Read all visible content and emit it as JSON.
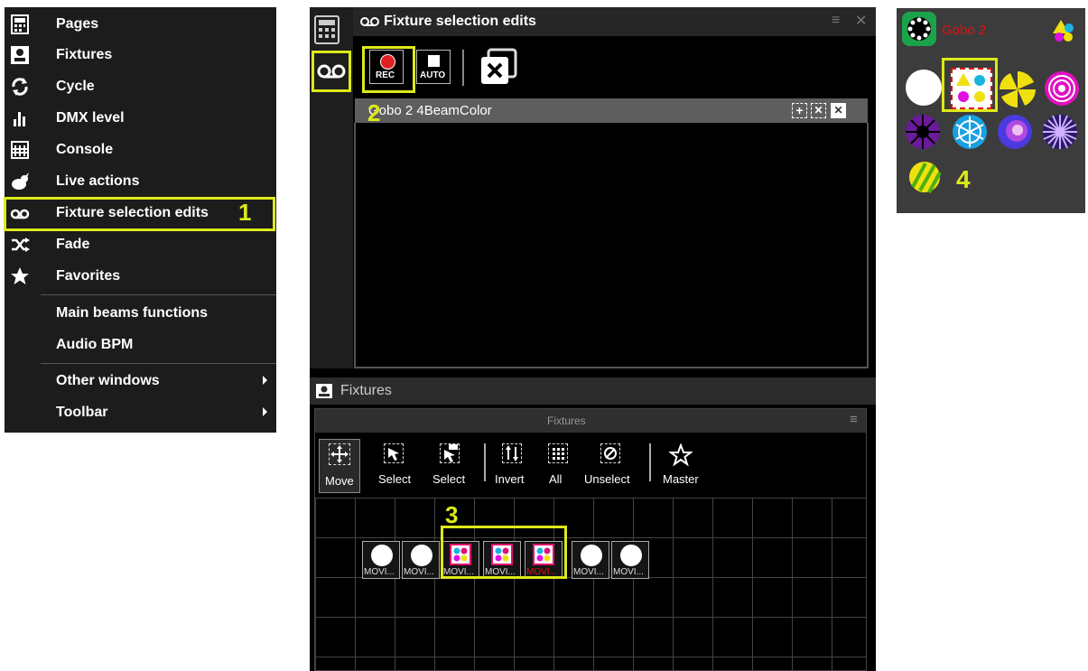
{
  "menu": {
    "items": [
      {
        "label": "Pages",
        "icon": "pages-grid-icon"
      },
      {
        "label": "Fixtures",
        "icon": "fixtures-icon"
      },
      {
        "label": "Cycle",
        "icon": "cycle-icon"
      },
      {
        "label": "DMX level",
        "icon": "dmx-level-icon"
      },
      {
        "label": "Console",
        "icon": "console-icon"
      },
      {
        "label": "Live actions",
        "icon": "live-actions-icon"
      },
      {
        "label": "Fixture selection edits",
        "icon": "fixture-selection-edits-icon"
      },
      {
        "label": "Fade",
        "icon": "fade-shuffle-icon"
      },
      {
        "label": "Favorites",
        "icon": "star-icon"
      },
      {
        "label": "Main beams functions"
      },
      {
        "label": "Audio BPM"
      },
      {
        "label": "Other windows"
      },
      {
        "label": "Toolbar"
      }
    ],
    "callout": "1"
  },
  "selection_panel": {
    "title": "Fixture selection edits",
    "rec_label": "REC",
    "auto_label": "AUTO",
    "callout": "2",
    "row_title": "Gobo 2 4BeamColor"
  },
  "fixtures_panel": {
    "title": "Fixtures",
    "subtitle": "Fixtures",
    "tools": [
      {
        "label": "Move"
      },
      {
        "label": "Select"
      },
      {
        "label": "Select"
      },
      {
        "label": "Invert"
      },
      {
        "label": "All"
      },
      {
        "label": "Unselect"
      },
      {
        "label": "Master"
      }
    ],
    "callout": "3",
    "fixtures": [
      {
        "label": "MOVI...",
        "selected": false,
        "color_label": false
      },
      {
        "label": "MOVI...",
        "selected": false,
        "color_label": false
      },
      {
        "label": "MOVI...",
        "selected": true,
        "color_label": false
      },
      {
        "label": "MOVI...",
        "selected": true,
        "color_label": false
      },
      {
        "label": "MOVI...",
        "selected": true,
        "color_label": true
      },
      {
        "label": "MOVI...",
        "selected": false,
        "color_label": false
      },
      {
        "label": "MOVI...",
        "selected": false,
        "color_label": false
      }
    ]
  },
  "gobo_panel": {
    "title": "Gobo 2",
    "callout": "4",
    "title_color": "#e01010"
  },
  "colors": {
    "highlight": "#dcea1a",
    "rec_red": "#e02020"
  }
}
